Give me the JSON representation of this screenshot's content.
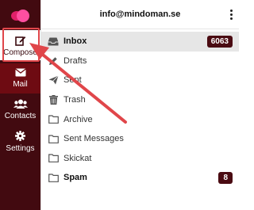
{
  "header": {
    "account": "info@mindoman.se"
  },
  "sidebar": {
    "compose_label": "Compose",
    "mail_label": "Mail",
    "contacts_label": "Contacts",
    "settings_label": "Settings"
  },
  "folders": [
    {
      "label": "Inbox",
      "icon": "inbox-icon",
      "count": "6063",
      "bold": true,
      "active": true
    },
    {
      "label": "Drafts",
      "icon": "pencil-icon"
    },
    {
      "label": "Sent",
      "icon": "paper-plane-icon"
    },
    {
      "label": "Trash",
      "icon": "trash-icon"
    },
    {
      "label": "Archive",
      "icon": "folder-icon"
    },
    {
      "label": "Sent Messages",
      "icon": "folder-icon"
    },
    {
      "label": "Skickat",
      "icon": "folder-icon"
    },
    {
      "label": "Spam",
      "icon": "folder-icon",
      "count": "8",
      "bold": true
    }
  ],
  "colors": {
    "sidebar": "#420a10",
    "sidebar_active": "#6e0b12",
    "badge": "#4a0b12",
    "annotation": "#e0464a",
    "logo": "#ff3d8b"
  }
}
